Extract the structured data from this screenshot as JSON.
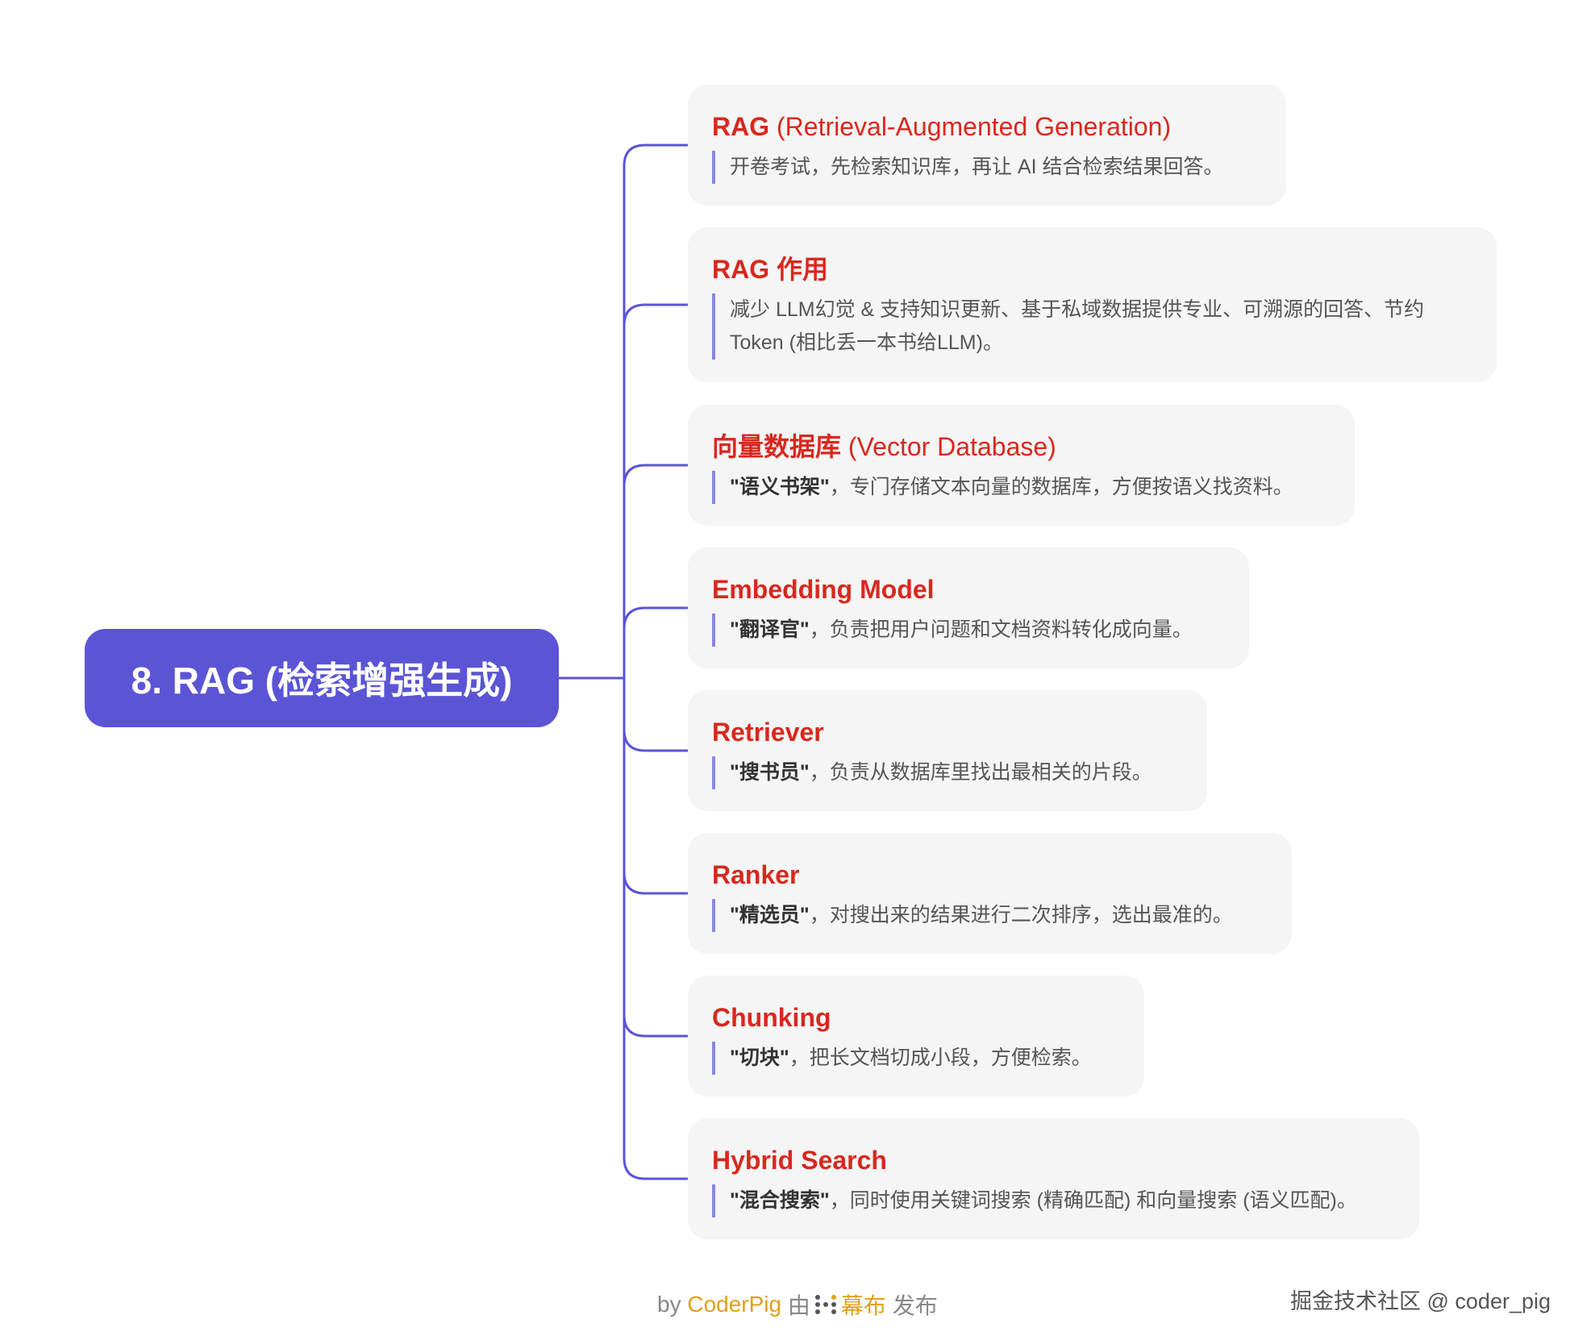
{
  "root": {
    "label": "8. RAG (检索增强生成)"
  },
  "nodes": [
    {
      "title_bold": "RAG",
      "title_rest": " (Retrieval-Augmented Generation)",
      "desc_quote": "",
      "desc": "开卷考试，先检索知识库，再让 AI 结合检索结果回答。"
    },
    {
      "title_bold": "RAG 作用",
      "title_rest": "",
      "desc_quote": "",
      "desc": "减少 LLM幻觉 & 支持知识更新、基于私域数据提供专业、可溯源的回答、节约 Token (相比丢一本书给LLM)。"
    },
    {
      "title_bold": "向量数据库",
      "title_rest": " (Vector Database)",
      "desc_quote": "\"语义书架\"",
      "desc": "，专门存储文本向量的数据库，方便按语义找资料。"
    },
    {
      "title_bold": "Embedding Model",
      "title_rest": "",
      "desc_quote": "\"翻译官\"",
      "desc": "，负责把用户问题和文档资料转化成向量。"
    },
    {
      "title_bold": "Retriever",
      "title_rest": "",
      "desc_quote": "\"搜书员\"",
      "desc": "，负责从数据库里找出最相关的片段。"
    },
    {
      "title_bold": "Ranker",
      "title_rest": "",
      "desc_quote": "\"精选员\"",
      "desc": "，对搜出来的结果进行二次排序，选出最准的。"
    },
    {
      "title_bold": "Chunking",
      "title_rest": "",
      "desc_quote": "\"切块\"",
      "desc": "，把长文档切成小段，方便检索。"
    },
    {
      "title_bold": "Hybrid Search",
      "title_rest": "",
      "desc_quote": "\"混合搜索\"",
      "desc": "，同时使用关键词搜索 (精确匹配) 和向量搜索 (语义匹配)。"
    }
  ],
  "footer": {
    "by": "by",
    "author": "CoderPig",
    "via": "由",
    "platform": "幕布",
    "action": "发布"
  },
  "watermark": "掘金技术社区 @ coder_pig",
  "colors": {
    "root_bg": "#5b55d6",
    "connector": "#5b55d6",
    "title": "#d9281e",
    "card_bg": "#f5f5f5",
    "desc_bar": "#8a86e6",
    "brand": "#e0a11a"
  }
}
